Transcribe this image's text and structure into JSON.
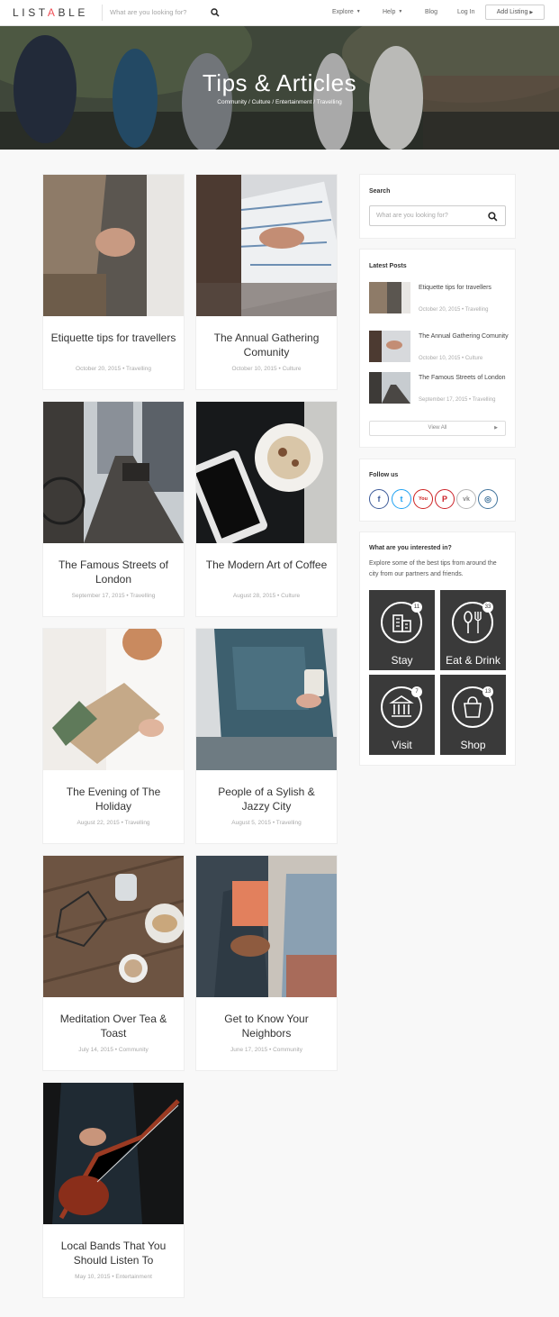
{
  "header": {
    "logo": {
      "pre": "LIST",
      "accent": "A",
      "post": "BLE"
    },
    "search_placeholder": "What are you looking for?",
    "nav": [
      {
        "label": "Explore",
        "caret": "▼"
      },
      {
        "label": "Help",
        "caret": "▼"
      },
      {
        "label": "Blog",
        "caret": ""
      },
      {
        "label": "Log In",
        "caret": ""
      }
    ],
    "add_listing": "Add Listing"
  },
  "hero": {
    "title": "Tips & Articles",
    "categories": [
      "Community",
      "Culture",
      "Entertainment",
      "Travelling"
    ],
    "separator": "/"
  },
  "posts": [
    {
      "title": "Etiquette tips for travellers",
      "date": "October 20, 2015",
      "category": "Travelling"
    },
    {
      "title": "The Annual Gathering Comunity",
      "date": "October 10, 2015",
      "category": "Culture"
    },
    {
      "title": "The Famous Streets of London",
      "date": "September 17, 2015",
      "category": "Travelling"
    },
    {
      "title": "The Modern Art of Coffee",
      "date": "August 28, 2015",
      "category": "Culture"
    },
    {
      "title": "The Evening of The Holiday",
      "date": "August 22, 2015",
      "category": "Travelling"
    },
    {
      "title": "People of a Sylish & Jazzy City",
      "date": "August 5, 2015",
      "category": "Travelling"
    },
    {
      "title": "Meditation Over Tea & Toast",
      "date": "July 14, 2015",
      "category": "Community"
    },
    {
      "title": "Get to Know Your Neighbors",
      "date": "June 17, 2015",
      "category": "Community"
    },
    {
      "title": "Local Bands That You Should Listen To",
      "date": "May 10, 2015",
      "category": "Entertainment"
    }
  ],
  "meta_separator": "•",
  "sidebar": {
    "search": {
      "title": "Search",
      "placeholder": "What are you looking for?"
    },
    "latest": {
      "title": "Latest Posts",
      "items": [
        {
          "title": "Etiquette tips for travellers",
          "date": "October 20, 2015",
          "category": "Travelling"
        },
        {
          "title": "The Annual Gathering Comunity",
          "date": "October 10, 2015",
          "category": "Culture"
        },
        {
          "title": "The Famous Streets of London",
          "date": "September 17, 2015",
          "category": "Travelling"
        }
      ],
      "view_all": "View All"
    },
    "follow": {
      "title": "Follow us",
      "networks": [
        {
          "icon": "facebook-icon",
          "glyph": "f",
          "color": "#3b5998"
        },
        {
          "icon": "twitter-icon",
          "glyph": "t",
          "color": "#1da1f2"
        },
        {
          "icon": "youtube-icon",
          "glyph": "You",
          "color": "#cd201f"
        },
        {
          "icon": "pinterest-icon",
          "glyph": "P",
          "color": "#cb2027"
        },
        {
          "icon": "vk-icon",
          "glyph": "vk",
          "color": "#8a8a8a"
        },
        {
          "icon": "instagram-icon",
          "glyph": "◎",
          "color": "#3f729b"
        }
      ]
    },
    "interests": {
      "title": "What are you interested in?",
      "text": "Explore some of the best tips from around the city from our partners and friends.",
      "tiles": [
        {
          "label": "Stay",
          "count": "11",
          "icon": "building-icon"
        },
        {
          "label": "Eat & Drink",
          "count": "33",
          "icon": "cutlery-icon"
        },
        {
          "label": "Visit",
          "count": "7",
          "icon": "museum-icon"
        },
        {
          "label": "Shop",
          "count": "13",
          "icon": "shopping-bag-icon"
        }
      ]
    }
  },
  "colors": {
    "accent": "#f04f56",
    "page_bg": "#f8f8f8"
  }
}
